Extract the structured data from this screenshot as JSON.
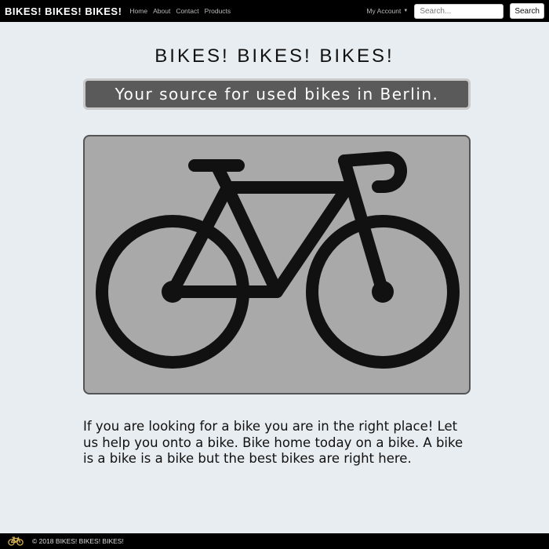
{
  "navbar": {
    "brand": "BIKES! BIKES! BIKES!",
    "links": [
      "Home",
      "About",
      "Contact",
      "Products"
    ],
    "account_label": "My Account",
    "search_placeholder": "Search...",
    "search_button": "Search"
  },
  "main": {
    "title": "BIKES! BIKES! BIKES!",
    "tagline": "Your source for used bikes in Berlin.",
    "hero_icon": "bicycle-icon",
    "description": "If you are looking for a bike you are in the right place! Let us help you onto a bike. Bike home today on a bike. A bike is a bike is a bike but the best bikes are right here."
  },
  "footer": {
    "icon": "bicycle-icon",
    "text": "© 2018 BIKES! BIKES! BIKES!"
  },
  "colors": {
    "navbar_bg": "#000000",
    "page_bg": "#e8edf1",
    "tagline_bg": "#5a5a5a",
    "hero_bg": "#a9a9a9",
    "footer_icon": "#d4b04c"
  }
}
